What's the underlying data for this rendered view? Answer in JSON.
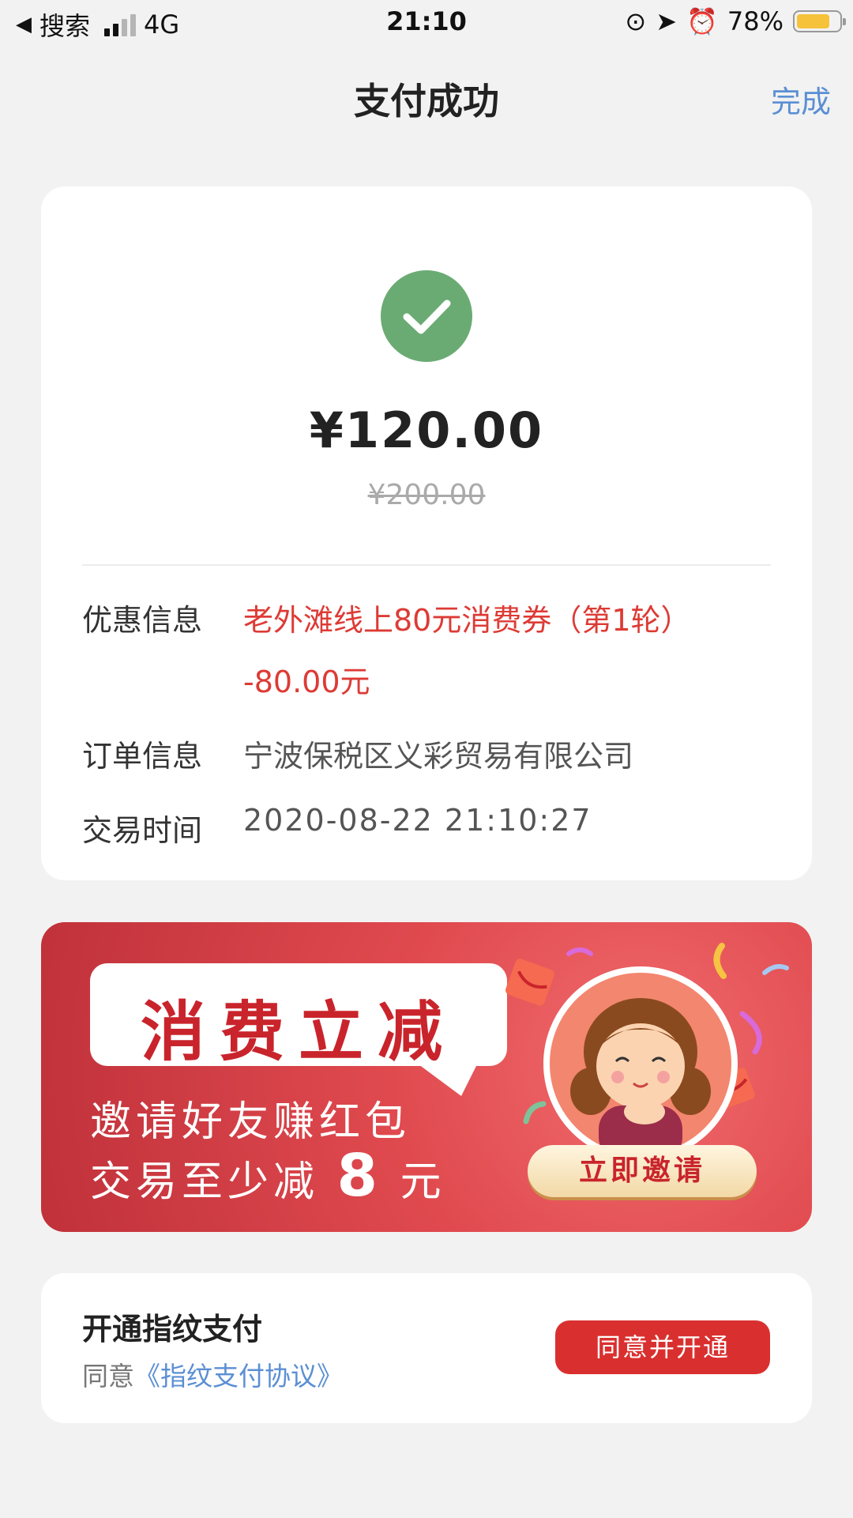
{
  "status_bar": {
    "back_app": "搜索",
    "network": "4G",
    "time": "21:10",
    "battery": "78%",
    "battery_level": 0.78
  },
  "nav": {
    "title": "支付成功",
    "done": "完成"
  },
  "payment": {
    "amount": "¥120.00",
    "original_amount": "¥200.00",
    "discount_label": "优惠信息",
    "discount_name": "老外滩线上80元消费券（第1轮）",
    "discount_value": "-80.00元",
    "order_label": "订单信息",
    "order_value": "宁波保税区义彩贸易有限公司",
    "time_label": "交易时间",
    "time_value": "2020-08-22  21:10:27"
  },
  "banner": {
    "headline": "消费立减",
    "line1": "邀请好友赚红包",
    "line2_prefix": "交易至少减",
    "line2_amount": "8",
    "line2_suffix": "元",
    "button": "立即邀请"
  },
  "fingerprint": {
    "title": "开通指纹支付",
    "agree_prefix": "同意",
    "agreement_link": "《指纹支付协议》",
    "button": "同意并开通"
  },
  "colors": {
    "accent_red": "#d9302f",
    "link_blue": "#5b8fd4",
    "success_green": "#6aab74"
  }
}
